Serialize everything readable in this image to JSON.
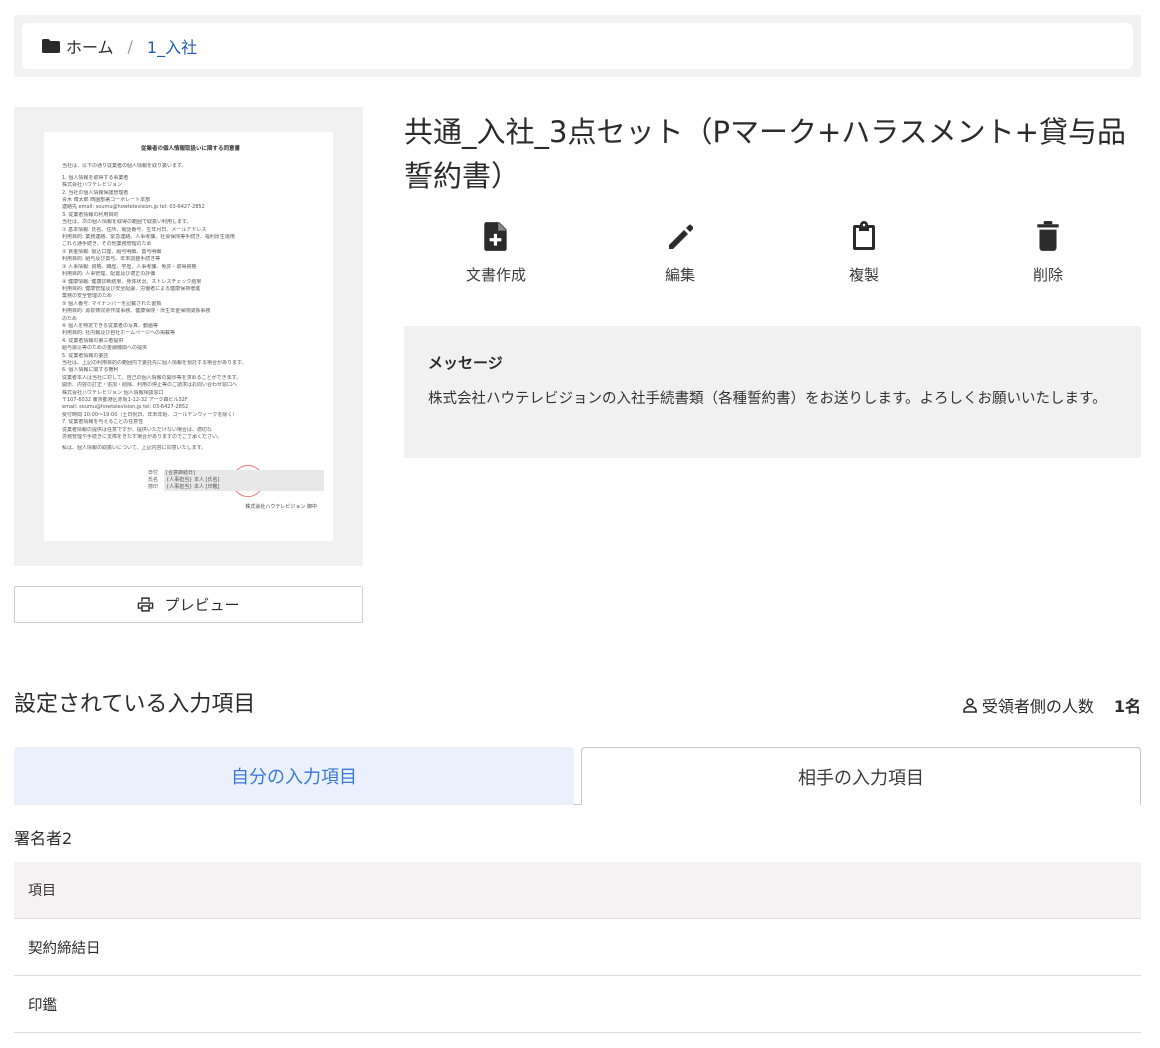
{
  "breadcrumb": {
    "home": "ホーム",
    "separator": "/",
    "current": "1_入社"
  },
  "document": {
    "title": "共通_入社_3点セット（Pマーク+ハラスメント+貸与品誓約書）",
    "thumbnail": {
      "heading": "従業者の個人情報取扱いに関する同意書",
      "lines": [
        "当社は、以下の通り従業者の個人情報を取り扱います。",
        "",
        "1.  個人情報を取得する事業者",
        "     株式会社ハウテレビジョン",
        "2.  当社の個人情報保護管理者",
        "     青木 博太郎  西園部署コーポレート本部",
        "     連絡先 email: soumu@howtelevision.jp  tel: 03-6427-2852",
        "3.  従業者情報の利用目的",
        "     当社は、次の個人情報を取得の範囲で取扱い利用します。",
        "     ① 基本情報: 氏名、住所、電話番号、生年月日、メールアドレス",
        "        利用目的: 業務連絡、緊急連絡、人事考課、社会保険等手続き、福利厚生運用",
        "        これら通手続き、その他業務管理のため",
        "     ② 賃金情報: 振込口座、給与明細、賞与明細",
        "        利用目的: 給与及び賞与、年末調整手続き等",
        "     ③ 人事情報: 資格、職歴、学歴、人事考課、免許・取得資格",
        "        利用目的: 人事管理、配置及び適正の評価",
        "     ④ 健康情報: 健康診断結果、身体状況、ストレスチェック結果",
        "        利用目的: 健康管理及び安全配慮、労働者による健康保持増進",
        "        業務の安全管理のため",
        "     ⑤ 個人番号: マイナンバーを記載された書類",
        "        利用目的: 源泉徴収票作成事務、健康保険・厚生年金保険関係事務",
        "        のため",
        "     ⑥ 個人を特定できる従業者の写真、動画等",
        "        利用目的: 社内報及び自社ホームページへの掲載等",
        "4.  従業者情報の第三者提供",
        "     給与振込等のための金融機関への提供",
        "5.  従業者情報の委託",
        "     当社は、上記の利用目的の範囲内で委託先に個人情報を預託する場合があります。",
        "6.  個人情報に関する権利",
        "     従業者本人は当社に対して、自己の個人情報の開示等を求めることができます。",
        "     開示、内容の訂正・追加・削除、利用の停止等のご請求はお問い合わせ窓口へ",
        "     株式会社ハウテレビジョン 個人情報相談窓口",
        "     〒107-6032 東京都港区赤坂1-12-32 アーク森ビル32F",
        "     email: soumu@howtelevision.jp  tel: 03-6427-2852",
        "     受付時間 10:00〜19:00（土日祝日、年末年始、ゴールデンウィークを除く）",
        "7.  従業者情報を与えることの任意性",
        "     従業者情報の提供は任意ですが、提供いただけない場合は、適切な",
        "     労務管理や手続きに支障をきたす場合がありますのでご了承ください。",
        "",
        "私は、個人情報の取扱いについて、上記内容に同意いたします。"
      ],
      "signature_rows": [
        {
          "label": "日付",
          "value": "[合意締結日]"
        },
        {
          "label": "氏名",
          "value": "{人事担当} 本人 [氏名]"
        },
        {
          "label": "捺印",
          "value": "{人事担当} 本人 [印鑑]"
        }
      ],
      "company": "株式会社ハウテレビジョン 御中"
    }
  },
  "preview_button": {
    "label": "プレビュー"
  },
  "actions": [
    {
      "label": "文書作成",
      "icon": "file-plus-icon"
    },
    {
      "label": "編集",
      "icon": "pencil-icon"
    },
    {
      "label": "複製",
      "icon": "clipboard-icon"
    },
    {
      "label": "削除",
      "icon": "trash-icon"
    }
  ],
  "message": {
    "title": "メッセージ",
    "text": "株式会社ハウテレビジョンの入社手続書類（各種誓約書）をお送りします。よろしくお願いいたします。"
  },
  "input_section": {
    "title": "設定されている入力項目",
    "recipients_label": "受領者側の人数",
    "recipients_count": "1名"
  },
  "tabs": {
    "mine": "自分の入力項目",
    "theirs": "相手の入力項目"
  },
  "signer": "署名者2",
  "fields_table": {
    "header": "項目",
    "rows": [
      "契約締結日",
      "印鑑"
    ]
  },
  "colors": {
    "accent": "#3a78d8",
    "link": "#1e5bb8",
    "tab_active_bg": "#eaf1fc",
    "panel_bg": "#f2f1f1"
  }
}
